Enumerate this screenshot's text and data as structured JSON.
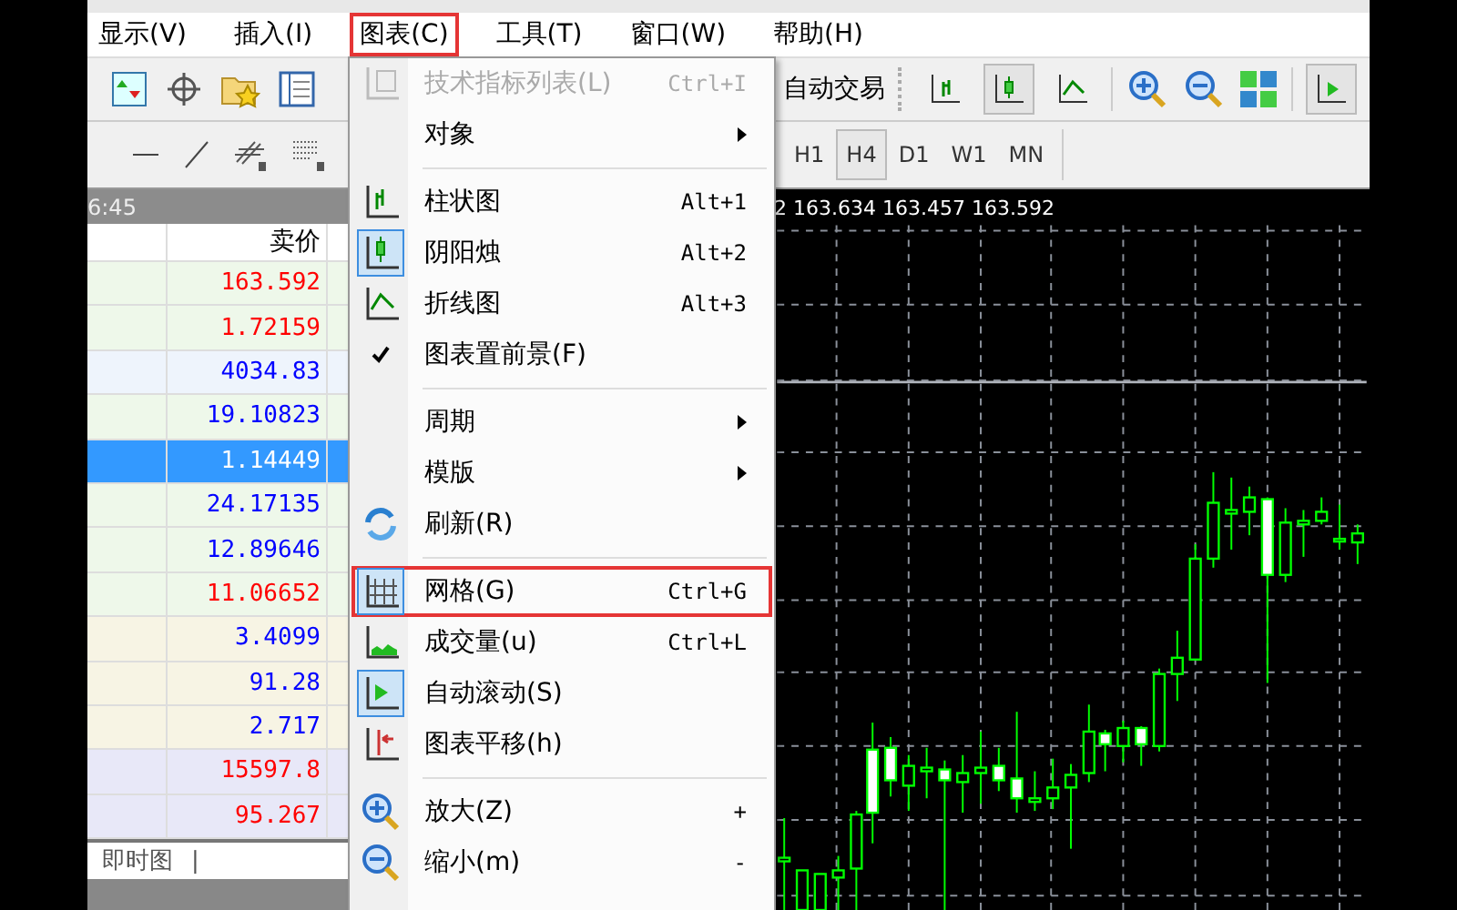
{
  "menu_bar": [
    {
      "label": "显示(V)",
      "highlighted": false
    },
    {
      "label": "插入(I)",
      "highlighted": false
    },
    {
      "label": "图表(C)",
      "highlighted": true
    },
    {
      "label": "工具(T)",
      "highlighted": false
    },
    {
      "label": "窗口(W)",
      "highlighted": false
    },
    {
      "label": "帮助(H)",
      "highlighted": false
    }
  ],
  "toolbar": {
    "auto_trading": "自动交易",
    "chart_buttons": [
      {
        "selected": false
      },
      {
        "selected": true
      },
      {
        "selected": false
      }
    ],
    "autoscroll_selected": true
  },
  "timeframes": [
    {
      "label": "H1",
      "selected": false
    },
    {
      "label": "H4",
      "selected": true
    },
    {
      "label": "D1",
      "selected": false
    },
    {
      "label": "W1",
      "selected": false
    },
    {
      "label": "MN",
      "selected": false
    }
  ],
  "market_watch": {
    "time": "6:45",
    "column_2": "卖价",
    "rows": [
      {
        "bid": "163.592",
        "color": "#ff0000",
        "selected": false
      },
      {
        "bid": "1.72159",
        "color": "#ff0000",
        "selected": false
      },
      {
        "bid": "4034.83",
        "color": "#0000ff",
        "selected": false
      },
      {
        "bid": "19.10823",
        "color": "#0000ff",
        "selected": false
      },
      {
        "bid": "1.14449",
        "selected": true
      },
      {
        "bid": "24.17135",
        "color": "#0000ff",
        "selected": false
      },
      {
        "bid": "12.89646",
        "color": "#0000ff",
        "selected": false
      },
      {
        "bid": "11.06652",
        "color": "#ff0000",
        "selected": false
      },
      {
        "bid": "3.4099",
        "color": "#0000ff",
        "selected": false
      },
      {
        "bid": "91.28",
        "color": "#0000ff",
        "selected": false
      },
      {
        "bid": "2.717",
        "color": "#0000ff",
        "selected": false
      },
      {
        "bid": "15597.8",
        "color": "#ff0000",
        "selected": false
      },
      {
        "bid": "95.267",
        "color": "#ff0000",
        "selected": false
      }
    ],
    "tab": "即时图",
    "tab_separator": "|"
  },
  "chart": {
    "prices": "2 163.634 163.457 163.592"
  },
  "dropdown": [
    {
      "kind": "item",
      "label": "技术指标列表(L)",
      "shortcut": "Ctrl+I",
      "disabled": true,
      "selected": false,
      "checked": false,
      "submenu": false,
      "highlighted": false
    },
    {
      "kind": "item",
      "label": "对象",
      "disabled": false,
      "selected": false,
      "checked": false,
      "submenu": true,
      "highlighted": false
    },
    {
      "kind": "separator"
    },
    {
      "kind": "item",
      "label": "柱状图",
      "shortcut": "Alt+1",
      "disabled": false,
      "selected": false,
      "checked": false,
      "submenu": false,
      "highlighted": false
    },
    {
      "kind": "item",
      "label": "阴阳烛",
      "shortcut": "Alt+2",
      "disabled": false,
      "selected": true,
      "checked": false,
      "submenu": false,
      "highlighted": false
    },
    {
      "kind": "item",
      "label": "折线图",
      "shortcut": "Alt+3",
      "disabled": false,
      "selected": false,
      "checked": false,
      "submenu": false,
      "highlighted": false
    },
    {
      "kind": "item",
      "label": "图表置前景(F)",
      "disabled": false,
      "selected": false,
      "checked": true,
      "submenu": false,
      "highlighted": false
    },
    {
      "kind": "separator"
    },
    {
      "kind": "item",
      "label": "周期",
      "disabled": false,
      "selected": false,
      "checked": false,
      "submenu": true,
      "highlighted": false
    },
    {
      "kind": "item",
      "label": "模版",
      "disabled": false,
      "selected": false,
      "checked": false,
      "submenu": true,
      "highlighted": false
    },
    {
      "kind": "item",
      "label": "刷新(R)",
      "disabled": false,
      "selected": false,
      "checked": false,
      "submenu": false,
      "highlighted": false
    },
    {
      "kind": "separator"
    },
    {
      "kind": "item",
      "label": "网格(G)",
      "shortcut": "Ctrl+G",
      "disabled": false,
      "selected": true,
      "checked": false,
      "submenu": false,
      "highlighted": true
    },
    {
      "kind": "item",
      "label": "成交量(u)",
      "shortcut": "Ctrl+L",
      "disabled": false,
      "selected": false,
      "checked": false,
      "submenu": false,
      "highlighted": false
    },
    {
      "kind": "item",
      "label": "自动滚动(S)",
      "disabled": false,
      "selected": true,
      "checked": false,
      "submenu": false,
      "highlighted": false
    },
    {
      "kind": "item",
      "label": "图表平移(h)",
      "disabled": false,
      "selected": false,
      "checked": false,
      "submenu": false,
      "highlighted": false
    },
    {
      "kind": "separator"
    },
    {
      "kind": "item",
      "label": "放大(Z)",
      "shortcut": "+",
      "disabled": false,
      "selected": false,
      "checked": false,
      "submenu": false,
      "highlighted": false
    },
    {
      "kind": "item",
      "label": "缩小(m)",
      "shortcut": "-",
      "disabled": false,
      "selected": false,
      "checked": false,
      "submenu": false,
      "highlighted": false
    }
  ]
}
